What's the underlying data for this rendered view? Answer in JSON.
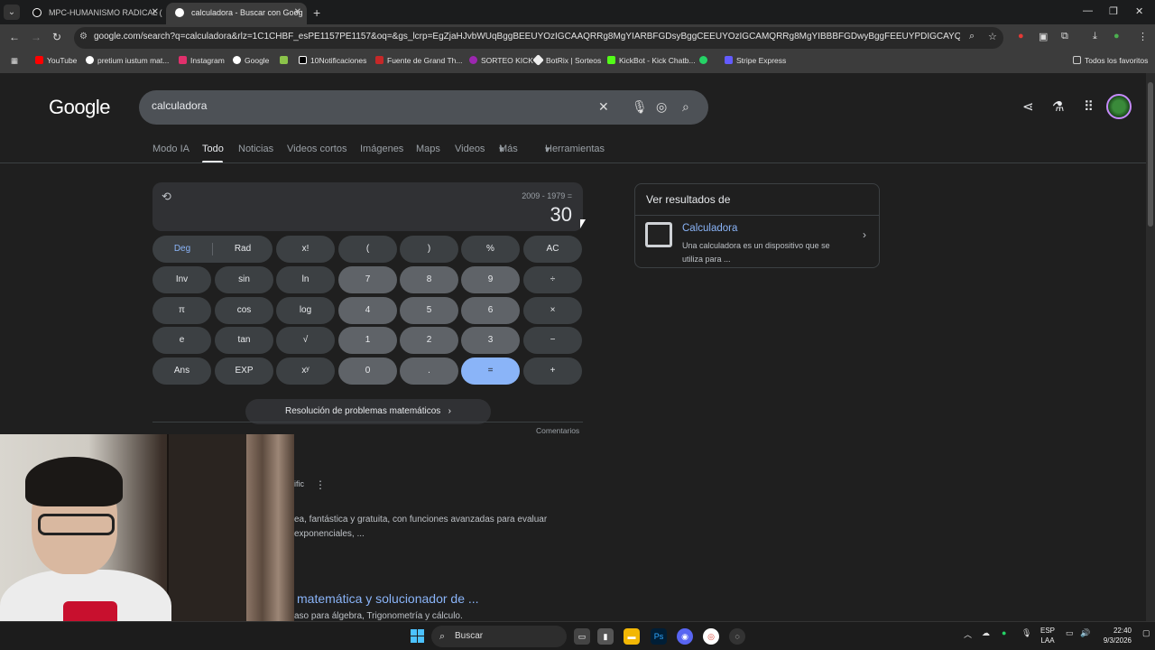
{
  "browser": {
    "tabs": [
      {
        "title": "MPC-HUMANISMO RADICAL (",
        "active": false
      },
      {
        "title": "calculadora - Buscar con Goog",
        "active": true
      }
    ],
    "url": "google.com/search?q=calculadora&rlz=1C1CHBF_esPE1157PE1157&oq=&gs_lcrp=EgZjaHJvbWUqBggBEEUYOzIGCAAQRRg8MgYIARBFGDsyBggCEEUYOzIGCAMQRRg8MgYIBBBFGDwyBggFEEUYPDIGCAYQRRg8MgYIBxAFGEDSAQc5...",
    "bookmarks": [
      "YouTube",
      "pretium iustum mat...",
      "Instagram",
      "Google",
      "10Notificaciones",
      "Fuente de Grand Th...",
      "SORTEO KICK",
      "BotRix | Sorteos",
      "KickBot - Kick Chatb...",
      "Stripe Express"
    ],
    "bookmarks_all": "Todos los favoritos"
  },
  "google": {
    "logo": "Google",
    "query": "calculadora",
    "tabs": [
      "Modo IA",
      "Todo",
      "Noticias",
      "Videos cortos",
      "Imágenes",
      "Maps",
      "Videos",
      "Más",
      "Herramientas"
    ],
    "active_tab": "Todo"
  },
  "calculator": {
    "expression": "2009 - 1979 =",
    "result": "30",
    "deg": "Deg",
    "rad": "Rad",
    "keys": {
      "fact": "x!",
      "lparen": "(",
      "rparen": ")",
      "percent": "%",
      "ac": "AC",
      "inv": "Inv",
      "sin": "sin",
      "ln": "ln",
      "k7": "7",
      "k8": "8",
      "k9": "9",
      "div": "÷",
      "pi": "π",
      "cos": "cos",
      "log": "log",
      "k4": "4",
      "k5": "5",
      "k6": "6",
      "mul": "×",
      "e": "e",
      "tan": "tan",
      "sqrt": "√",
      "k1": "1",
      "k2": "2",
      "k3": "3",
      "sub": "−",
      "ans": "Ans",
      "exp": "EXP",
      "pow": "xʸ",
      "k0": "0",
      "dot": ".",
      "eq": "=",
      "add": "+"
    },
    "math_solver": "Resolución de problemas matemáticos",
    "comments": "Comentarios"
  },
  "side_panel": {
    "heading": "Ver resultados de",
    "title": "Calculadora",
    "description": "Una calculadora es un dispositivo que se utiliza para ..."
  },
  "results": {
    "partial_source": "ific",
    "snippet_1": "ea, fantástica y gratuita, con funciones avanzadas para evaluar",
    "snippet_2": "exponenciales, ...",
    "link_title": "matemática y solucionador de ...",
    "snippet_3": "aso para álgebra, Trigonometría y cálculo."
  },
  "taskbar": {
    "search": "Buscar",
    "lang_1": "ESP",
    "lang_2": "LAA",
    "time": "22:40",
    "date": "9/3/2026"
  }
}
